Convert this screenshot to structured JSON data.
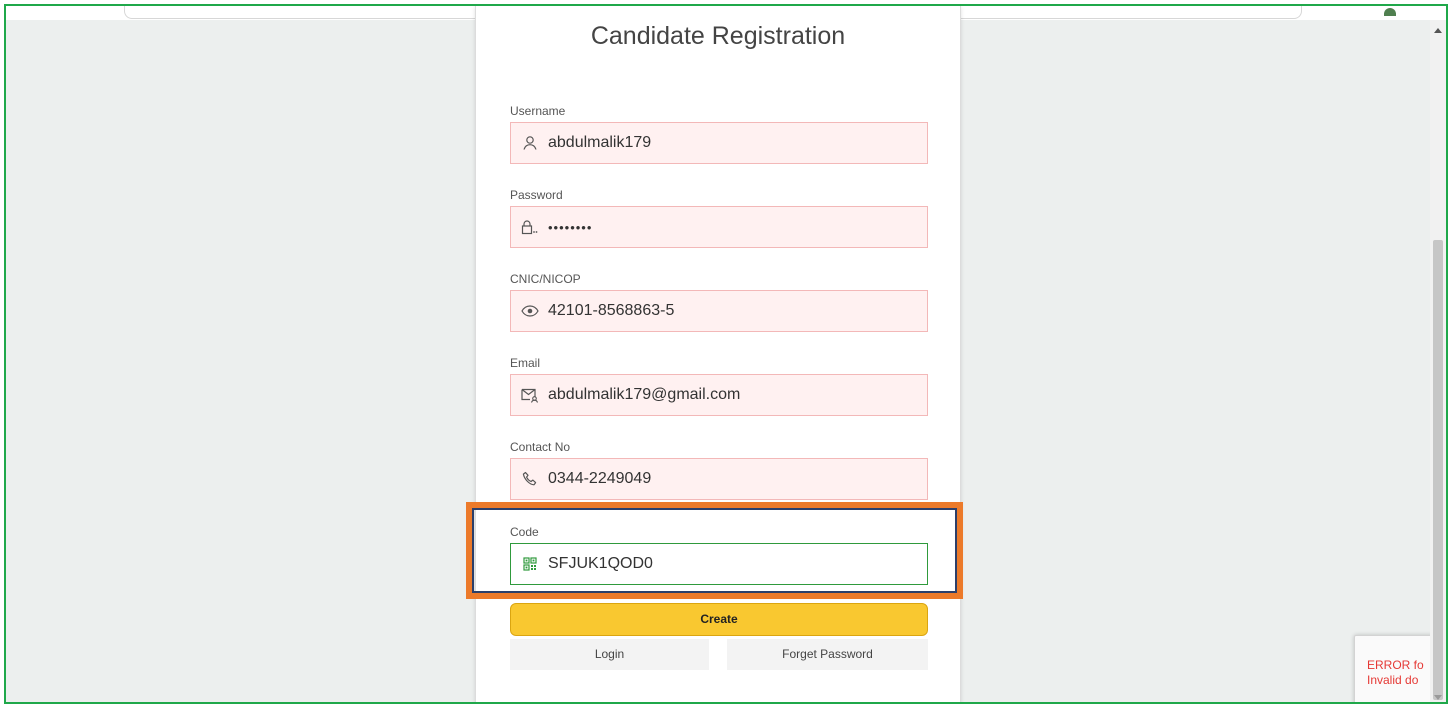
{
  "form": {
    "title": "Candidate Registration",
    "fields": [
      {
        "label": "Username",
        "value": "abdulmalik179",
        "icon": "user-icon"
      },
      {
        "label": "Password",
        "value": "••••••••",
        "icon": "lock-icon"
      },
      {
        "label": "CNIC/NICOP",
        "value": "42101-8568863-5",
        "icon": "eye-icon"
      },
      {
        "label": "Email",
        "value": "abdulmalik179@gmail.com",
        "icon": "mail-icon"
      },
      {
        "label": "Contact No",
        "value": "0344-2249049",
        "icon": "phone-icon"
      },
      {
        "label": "Code",
        "value": "SFJUK1QOD0",
        "icon": "qr-code-icon"
      }
    ],
    "create_label": "Create",
    "login_label": "Login",
    "forget_label": "Forget Password"
  },
  "recaptcha": {
    "error_line1": "ERROR fo",
    "error_line2": "Invalid do"
  },
  "colors": {
    "accent": "#f9c830",
    "highlight_border": "#ec7a2a",
    "highlight_outline": "#2c3f6a",
    "code_field_border": "#2f9a3c",
    "field_bg": "#fff1f1",
    "error_text": "#e53935"
  }
}
